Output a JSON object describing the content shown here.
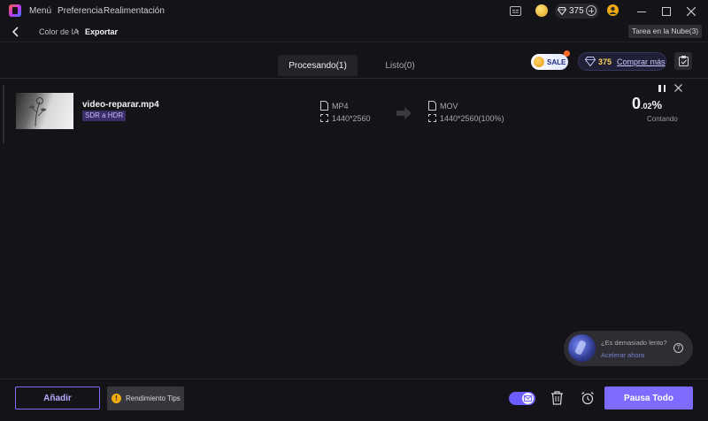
{
  "titlebar": {
    "menu": [
      "Menú",
      "Preferencia",
      "Realimentación"
    ],
    "credits": "375"
  },
  "breadcrumb": {
    "items": [
      "Color de IA",
      "Exportar"
    ],
    "cloud_task": "Tarea en la Nube(3)"
  },
  "tabs": {
    "processing": "Procesando(1)",
    "done": "Listo(0)"
  },
  "promo": {
    "sale": "SALE",
    "credits": "375",
    "buy_more": "Comprar más"
  },
  "task": {
    "file_name": "video-reparar.mp4",
    "mode": "SDR a HDR",
    "source": {
      "format": "MP4",
      "resolution": "1440*2560"
    },
    "target": {
      "format": "MOV",
      "resolution": "1440*2560(100%)"
    },
    "progress": {
      "int": "0",
      "dec": ".02",
      "symbol": "%",
      "value_percent": 0.02
    },
    "status": "Contando"
  },
  "help": {
    "question": "¿Es demasiado lento?",
    "link": "Acelerar ahora",
    "icon": "?"
  },
  "bottom": {
    "add": "Añadir",
    "tips": "Rendimiento Tips",
    "tips_icon": "!",
    "pause_all": "Pausa Todo"
  },
  "colors": {
    "accent": "#7d6cff",
    "background": "#141418",
    "coin": "#e0a21c",
    "warning": "#f0a90e"
  },
  "icons": [
    "app-logo-icon",
    "captions-icon",
    "coin-icon",
    "diamond-icon",
    "plus-icon",
    "user-icon",
    "minimize-icon",
    "maximize-icon",
    "close-icon",
    "chevron-left-icon",
    "clipboard-icon",
    "file-icon",
    "resize-icon",
    "arrow-right-icon",
    "pause-icon",
    "trash-icon",
    "alarm-clock-icon",
    "mail-icon",
    "help-icon"
  ]
}
